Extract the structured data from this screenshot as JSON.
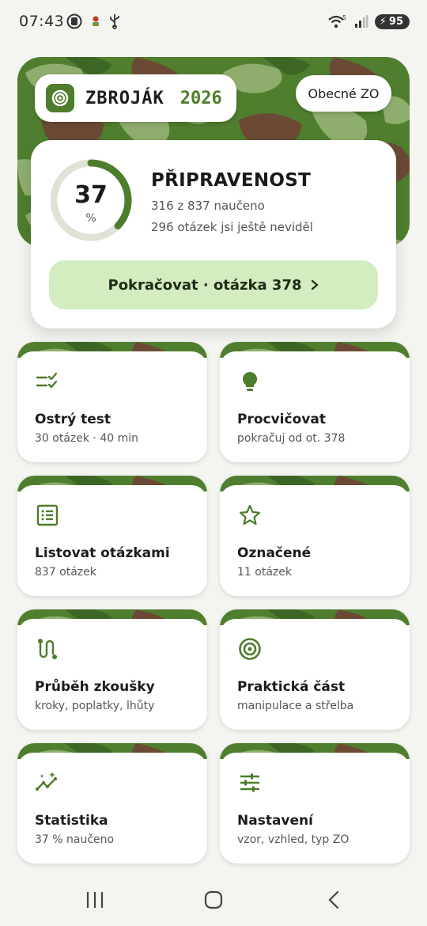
{
  "status_bar": {
    "time": "07:43",
    "battery": "95",
    "left_icons": [
      "notification-icon",
      "app-icon",
      "usb-icon"
    ],
    "right_icons": [
      "wifi-icon",
      "signal-icon",
      "battery-icon"
    ]
  },
  "header": {
    "logo_text": "ZBROJÁK",
    "year": "2026",
    "zo_button": "Obecné ZO"
  },
  "readiness": {
    "percent": "37",
    "percent_sign": "%",
    "progress": 0.37,
    "title": "PŘIPRAVENOST",
    "learned_line": "316 z 837 naučeno",
    "unseen_line": "296 otázek jsi ještě neviděl",
    "continue_label": "Pokračovat · otázka 378"
  },
  "tiles": [
    {
      "title": "Ostrý test",
      "subtitle": "30 otázek · 40 min",
      "icon": "checklist-icon"
    },
    {
      "title": "Procvičovat",
      "subtitle": "pokračuj od ot. 378",
      "icon": "lightbulb-icon"
    },
    {
      "title": "Listovat otázkami",
      "subtitle": "837 otázek",
      "icon": "list-icon"
    },
    {
      "title": "Označené",
      "subtitle": "11 otázek",
      "icon": "star-icon"
    },
    {
      "title": "Průběh zkoušky",
      "subtitle": "kroky, poplatky, lhůty",
      "icon": "route-icon"
    },
    {
      "title": "Praktická část",
      "subtitle": "manipulace a střelba",
      "icon": "target-icon"
    },
    {
      "title": "Statistika",
      "subtitle": "37 % naučeno",
      "icon": "trend-icon"
    },
    {
      "title": "Nastavení",
      "subtitle": "vzor, vzhled, typ ZO",
      "icon": "sliders-icon"
    }
  ],
  "colors": {
    "accent": "#4e7d2c",
    "continue_bg": "#d3ecc0",
    "camo_base": "#4f7f2e",
    "camo_light": "#8fae6e",
    "camo_brown": "#6b4a35",
    "background": "#f4f4f1"
  },
  "nav": [
    "recents-icon",
    "home-icon",
    "back-icon"
  ]
}
